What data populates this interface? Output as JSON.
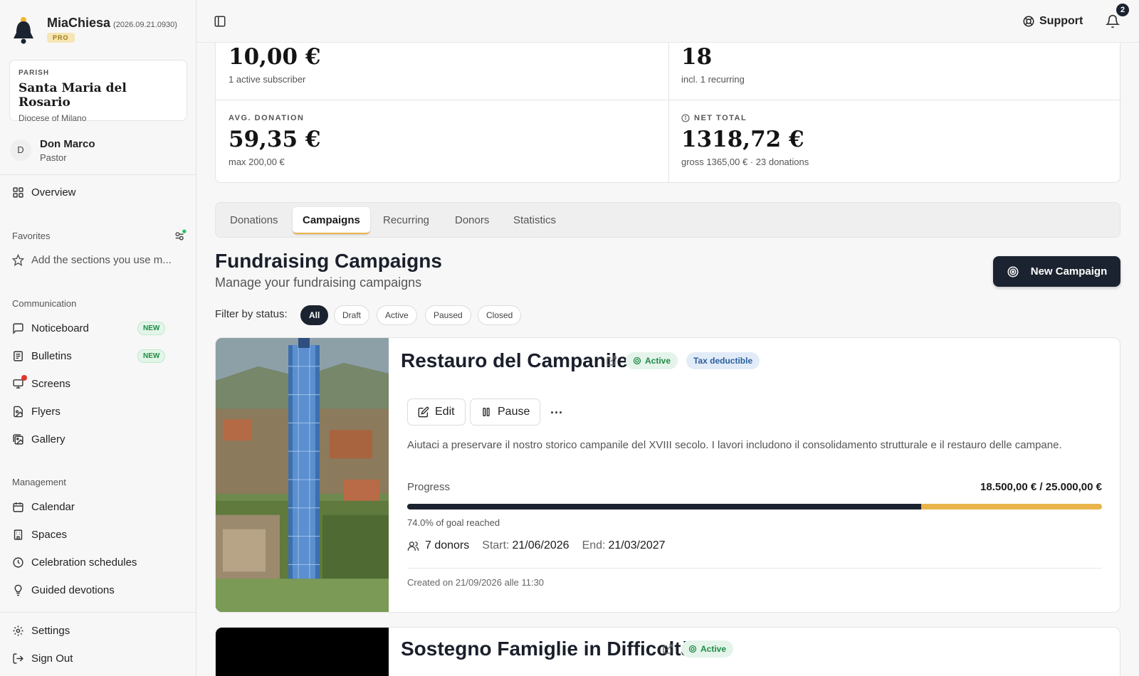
{
  "app": {
    "name": "MiaChiesa",
    "version": "(2026.09.21.0930)",
    "plan_badge": "PRO"
  },
  "parish": {
    "label": "PARISH",
    "name": "Santa Maria del Rosario",
    "diocese": "Diocese of Milano"
  },
  "user": {
    "initial": "D",
    "name": "Don Marco",
    "role": "Pastor"
  },
  "sidebar": {
    "overview": "Overview",
    "favorites_label": "Favorites",
    "favorites_hint": "Add the sections you use m...",
    "communication_label": "Communication",
    "communication": [
      {
        "label": "Noticeboard",
        "badge": "NEW",
        "icon": "message-square-icon"
      },
      {
        "label": "Bulletins",
        "badge": "NEW",
        "icon": "newspaper-icon"
      },
      {
        "label": "Screens",
        "badge": "",
        "icon": "monitor-icon"
      },
      {
        "label": "Flyers",
        "badge": "",
        "icon": "file-image-icon"
      },
      {
        "label": "Gallery",
        "badge": "",
        "icon": "images-icon"
      }
    ],
    "management_label": "Management",
    "management": [
      {
        "label": "Calendar",
        "icon": "calendar-icon"
      },
      {
        "label": "Spaces",
        "icon": "building-icon"
      },
      {
        "label": "Celebration schedules",
        "icon": "clock-icon"
      },
      {
        "label": "Guided devotions",
        "icon": "lightbulb-icon"
      }
    ],
    "settings": "Settings",
    "sign_out": "Sign Out"
  },
  "topbar": {
    "support": "Support",
    "notification_count": "2"
  },
  "stats": {
    "top_left": {
      "value": "10,00 €",
      "sub": "1 active subscriber"
    },
    "top_right": {
      "value": "18",
      "sub": "incl. 1 recurring"
    },
    "bottom_left": {
      "label": "AVG. DONATION",
      "value": "59,35 €",
      "sub": "max 200,00 €"
    },
    "bottom_right": {
      "label": "NET TOTAL",
      "value": "1318,72 €",
      "sub": "gross 1365,00 € · 23 donations"
    }
  },
  "tabs": [
    "Donations",
    "Campaigns",
    "Recurring",
    "Donors",
    "Statistics"
  ],
  "active_tab": "Campaigns",
  "page": {
    "title": "Fundraising Campaigns",
    "subtitle": "Manage your fundraising campaigns",
    "new_button": "New Campaign",
    "filter_label": "Filter by status:",
    "filters": [
      "All",
      "Draft",
      "Active",
      "Paused",
      "Closed"
    ],
    "selected_filter": "All"
  },
  "campaigns": [
    {
      "title": "Restauro del Campanile",
      "status": "Active",
      "tag": "Tax deductible",
      "edit_label": "Edit",
      "pause_label": "Pause",
      "more_label": "···",
      "description": "Aiutaci a preservare il nostro storico campanile del XVIII secolo. I lavori includono il consolidamento strutturale e il restauro delle campane.",
      "progress_label": "Progress",
      "amount": "18.500,00 € / 25.000,00 €",
      "progress_fraction": 0.74,
      "goal_text": "74.0% of goal reached",
      "donors": "7 donors",
      "start_label": "Start:",
      "start": "21/06/2026",
      "end_label": "End:",
      "end": "21/03/2027",
      "created": "Created on 21/09/2026 alle 11:30"
    },
    {
      "title": "Sostegno Famiglie in Difficoltà",
      "status": "Active"
    }
  ],
  "colors": {
    "primary": "#1c2330",
    "accent": "#e9b44c",
    "success": "#1e8a46"
  }
}
